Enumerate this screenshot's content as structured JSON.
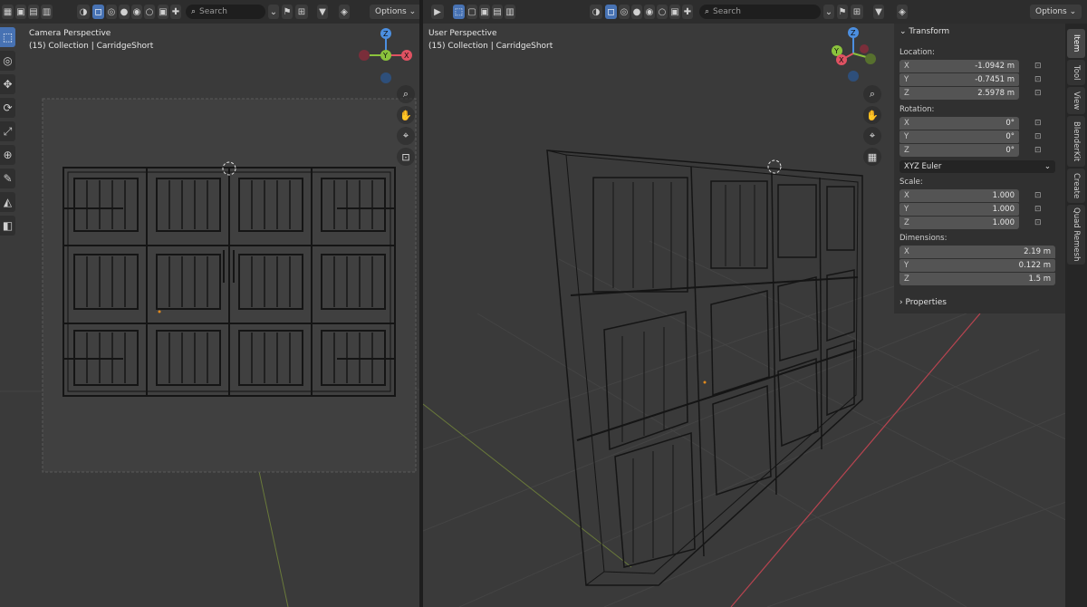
{
  "left_view": {
    "overlay_title": "Camera Perspective",
    "overlay_subtitle": "(15) Collection | CarridgeShort",
    "search_placeholder": "Search",
    "options_label": "Options",
    "gizmo_axes": {
      "z": "Z",
      "y": "Y",
      "x": "X"
    }
  },
  "right_view": {
    "overlay_title": "User Perspective",
    "overlay_subtitle": "(15) Collection | CarridgeShort",
    "search_placeholder": "Search",
    "options_label": "Options",
    "gizmo_axes": {
      "z": "Z",
      "y": "Y",
      "x": "X"
    }
  },
  "npanel": {
    "transform_header": "Transform",
    "location_label": "Location:",
    "location": [
      {
        "axis": "X",
        "value": "-1.0942 m"
      },
      {
        "axis": "Y",
        "value": "-0.7451 m"
      },
      {
        "axis": "Z",
        "value": "2.5978 m"
      }
    ],
    "rotation_label": "Rotation:",
    "rotation": [
      {
        "axis": "X",
        "value": "0°"
      },
      {
        "axis": "Y",
        "value": "0°"
      },
      {
        "axis": "Z",
        "value": "0°"
      }
    ],
    "rotation_mode": "XYZ Euler",
    "scale_label": "Scale:",
    "scale": [
      {
        "axis": "X",
        "value": "1.000"
      },
      {
        "axis": "Y",
        "value": "1.000"
      },
      {
        "axis": "Z",
        "value": "1.000"
      }
    ],
    "dimensions_label": "Dimensions:",
    "dimensions": [
      {
        "axis": "X",
        "value": "2.19 m"
      },
      {
        "axis": "Y",
        "value": "0.122 m"
      },
      {
        "axis": "Z",
        "value": "1.5 m"
      }
    ],
    "properties_header": "Properties"
  },
  "sidebar_tabs": [
    "Item",
    "Tool",
    "View",
    "BlenderKit",
    "Create",
    "Quad Remesh"
  ],
  "colors": {
    "accent": "#4772b3",
    "axis_x": "#e05262",
    "axis_y": "#8bc33c",
    "axis_z": "#4c8fe0",
    "viewport_bg": "#3a3a3a"
  },
  "icons": {
    "cursor": "cursor-icon",
    "move": "move-icon",
    "rotate": "rotate-icon",
    "scale": "scale-icon",
    "transform": "transform-icon",
    "annotate": "annotate-icon",
    "measure": "measure-icon",
    "add_cube": "add-cube-icon",
    "zoom": "zoom-icon",
    "pan": "hand-icon",
    "camera": "camera-icon",
    "lock": "lock-icon",
    "grid": "grid-icon"
  }
}
